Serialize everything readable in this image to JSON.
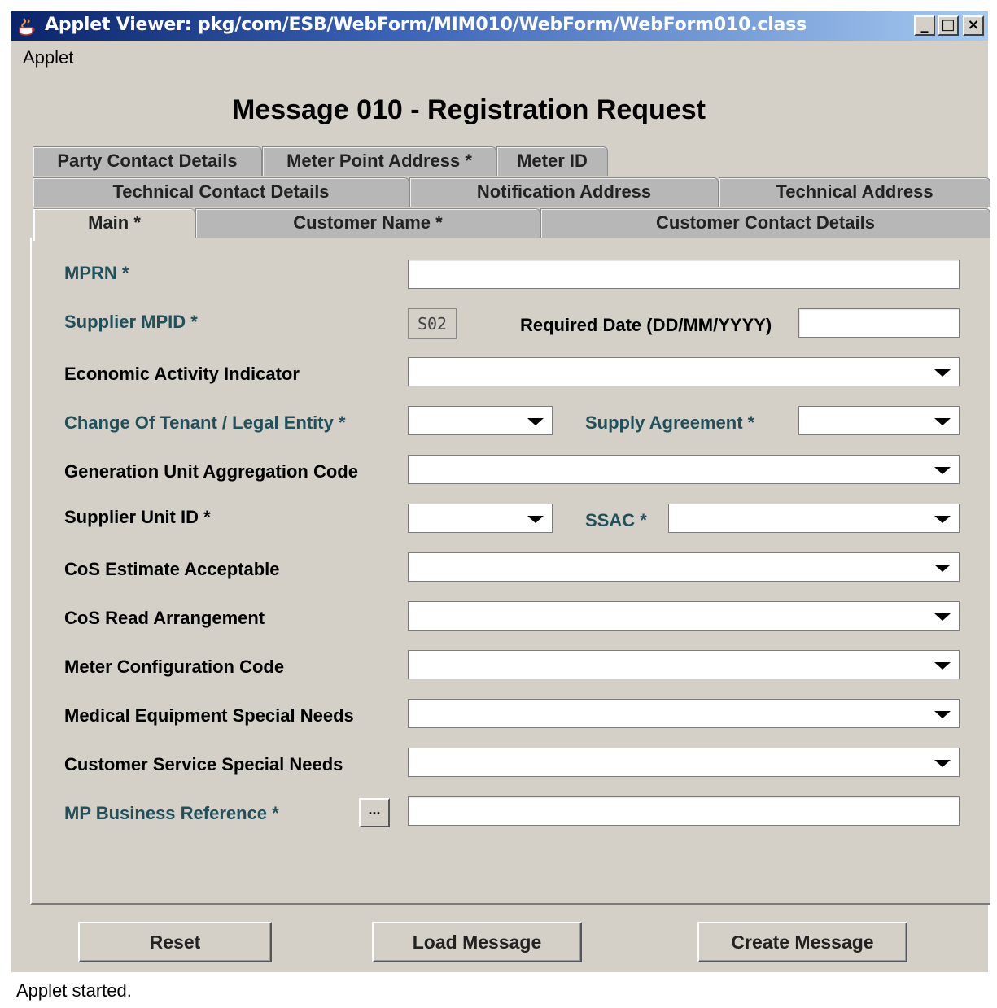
{
  "window": {
    "title": "Applet Viewer: pkg/com/ESB/WebForm/MIM010/WebForm/WebForm010.class",
    "minimize_label": "_",
    "maximize_label": "□",
    "close_label": "×"
  },
  "menu": {
    "applet": "Applet"
  },
  "form": {
    "title": "Message 010 - Registration Request"
  },
  "tabs": {
    "row1": [
      "Party Contact Details",
      "Meter Point Address *",
      "Meter ID"
    ],
    "row2": [
      "Technical Contact Details",
      "Notification Address",
      "Technical Address"
    ],
    "row3": [
      "Main *",
      "Customer Name *",
      "Customer Contact Details"
    ],
    "active": "Main *"
  },
  "fields": {
    "mprn": {
      "label": "MPRN *",
      "value": ""
    },
    "supplier_mpid": {
      "label": "Supplier MPID *",
      "value": "S02"
    },
    "required_date": {
      "label": "Required Date (DD/MM/YYYY)",
      "value": ""
    },
    "economic_activity": {
      "label": "Economic Activity Indicator",
      "value": ""
    },
    "change_of_tenant": {
      "label": "Change Of Tenant / Legal Entity *",
      "value": ""
    },
    "supply_agreement": {
      "label": "Supply Agreement *",
      "value": ""
    },
    "generation_unit": {
      "label": "Generation Unit Aggregation Code",
      "value": ""
    },
    "supplier_unit_id": {
      "label": "Supplier Unit ID *",
      "value": ""
    },
    "ssac": {
      "label": "SSAC *",
      "value": ""
    },
    "cos_estimate": {
      "label": "CoS Estimate Acceptable",
      "value": ""
    },
    "cos_read": {
      "label": "CoS Read Arrangement",
      "value": ""
    },
    "meter_config": {
      "label": "Meter Configuration Code",
      "value": ""
    },
    "medical_equipment": {
      "label": "Medical Equipment Special Needs",
      "value": ""
    },
    "customer_service": {
      "label": "Customer Service Special Needs",
      "value": ""
    },
    "mp_business_ref": {
      "label": "MP Business Reference *",
      "value": "",
      "button": "..."
    }
  },
  "buttons": {
    "reset": "Reset",
    "load": "Load Message",
    "create": "Create Message"
  },
  "status": {
    "text": "Applet started."
  },
  "colors": {
    "required_label": "#20505a",
    "title_bar": "#0a246a",
    "window_bg": "#d4d0c8"
  }
}
